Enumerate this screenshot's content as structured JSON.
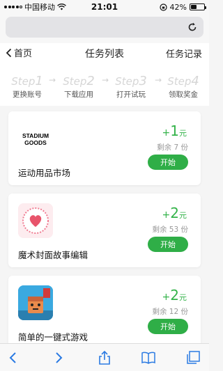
{
  "status": {
    "carrier": "中国移动",
    "time": "21:01",
    "battery": "42%",
    "battery_level": 0.42
  },
  "nav": {
    "back_label": "首页",
    "title": "任务列表",
    "records_label": "任务记录"
  },
  "steps": [
    {
      "step": "Step",
      "num": "1",
      "label": "更换账号"
    },
    {
      "step": "Step",
      "num": "2",
      "label": "下载应用"
    },
    {
      "step": "Step",
      "num": "3",
      "label": "打开试玩"
    },
    {
      "step": "Step",
      "num": "4",
      "label": "领取奖金"
    }
  ],
  "tasks": [
    {
      "name": "运动用品市场",
      "plus": "+",
      "amount": "1",
      "unit": "元",
      "remaining": "剩余 7 份",
      "button": "开始",
      "icon_text": "STADIUM GOODS"
    },
    {
      "name": "魔术封面故事编辑",
      "plus": "+",
      "amount": "2",
      "unit": "元",
      "remaining": "剩余 53 份",
      "button": "开始"
    },
    {
      "name": "简单的一键式游戏",
      "plus": "+",
      "amount": "2",
      "unit": "元",
      "remaining": "剩余 12 份",
      "button": "开始"
    }
  ],
  "colors": {
    "accent": "#2fae47",
    "reward": "#34b34a"
  },
  "icons": [
    "chevron-left-icon",
    "chevron-right-icon",
    "share-icon",
    "book-icon",
    "tabs-icon",
    "reload-icon",
    "wifi-icon"
  ]
}
